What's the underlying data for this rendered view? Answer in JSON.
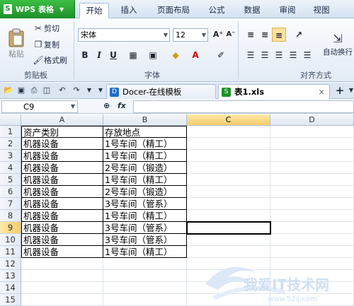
{
  "app": {
    "logo_text": "WPS 表格",
    "logo_mark": "S"
  },
  "menu": [
    "开始",
    "插入",
    "页面布局",
    "公式",
    "数据",
    "审阅",
    "视图"
  ],
  "ribbon": {
    "clipboard": {
      "paste": "粘贴",
      "cut": "剪切",
      "copy": "复制",
      "format_painter": "格式刷",
      "group_label": "剪贴板"
    },
    "font": {
      "font_name": "宋体",
      "font_size": "12",
      "bold": "B",
      "italic": "I",
      "underline": "U",
      "grow": "A⁺",
      "shrink": "A⁻",
      "group_label": "字体"
    },
    "alignment": {
      "wrap_text": "自动换行",
      "group_label": "对齐方式"
    }
  },
  "tabs": {
    "docer": "Docer-在线模板",
    "file": "表1.xls",
    "add": "+"
  },
  "formula_bar": {
    "name_box": "C9",
    "fx": "fx",
    "value": ""
  },
  "sheet": {
    "columns": [
      "A",
      "B",
      "C",
      "D"
    ],
    "rows": [
      "1",
      "2",
      "3",
      "4",
      "5",
      "6",
      "7",
      "8",
      "9",
      "10",
      "11",
      "12",
      "13",
      "14",
      "15"
    ],
    "cells": [
      [
        "资产类别",
        "存放地点"
      ],
      [
        "机器设备",
        "1号车间（精工）"
      ],
      [
        "机器设备",
        "1号车间（精工）"
      ],
      [
        "机器设备",
        "2号车间（锻造）"
      ],
      [
        "机器设备",
        "1号车间（精工）"
      ],
      [
        "机器设备",
        "2号车间（锻造）"
      ],
      [
        "机器设备",
        "3号车间（管系）"
      ],
      [
        "机器设备",
        "1号车间（精工）"
      ],
      [
        "机器设备",
        "3号车间（管系）"
      ],
      [
        "机器设备",
        "3号车间（管系）"
      ],
      [
        "机器设备",
        "1号车间（精工）"
      ]
    ]
  },
  "watermark": {
    "text": "我爱IT技术网",
    "url": "www.52ij.com"
  },
  "colors": {
    "accent": "#1e8f29",
    "selection": "#f8cc6b",
    "ribbon_bg": "#e3ebf6"
  }
}
